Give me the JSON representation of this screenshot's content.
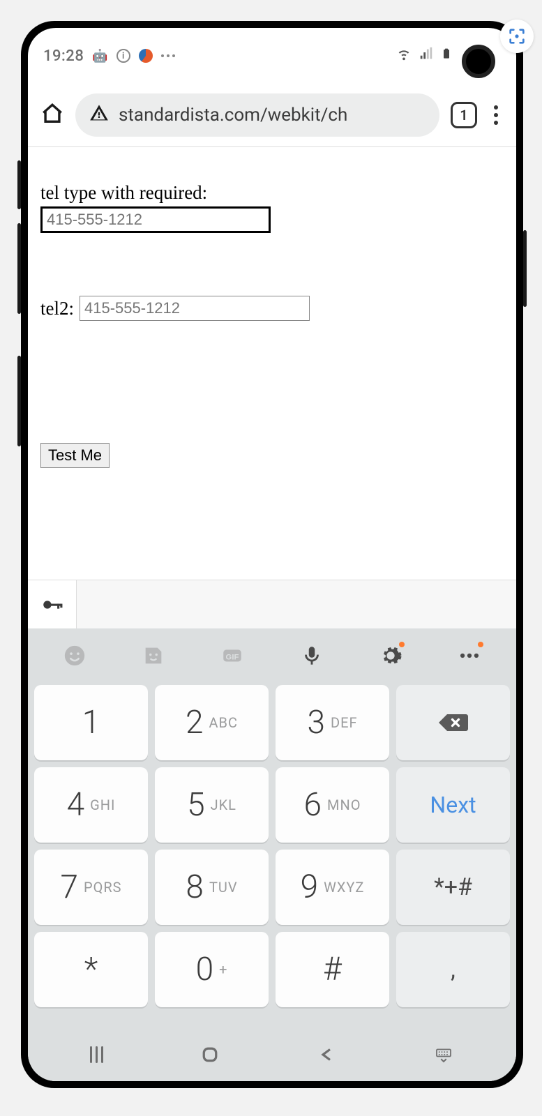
{
  "statusbar": {
    "time": "19:28",
    "icons": [
      "android-icon",
      "info-icon",
      "swirl-icon",
      "more-icon"
    ],
    "right_icons": [
      "wifi-icon",
      "signal-icon",
      "battery-icon"
    ]
  },
  "browser": {
    "url": "standardista.com/webkit/ch",
    "tab_count": "1"
  },
  "page": {
    "label1": "tel type with required:",
    "tel1_placeholder": "415-555-1212",
    "label2": "tel2:",
    "tel2_placeholder": "415-555-1212",
    "button": "Test Me"
  },
  "keyboard": {
    "toolbar": [
      "emoji",
      "sticker",
      "gif",
      "mic",
      "settings",
      "more"
    ],
    "rows": [
      [
        {
          "n": "1",
          "s": ""
        },
        {
          "n": "2",
          "s": "ABC"
        },
        {
          "n": "3",
          "s": "DEF"
        },
        {
          "fn": "backspace"
        }
      ],
      [
        {
          "n": "4",
          "s": "GHI"
        },
        {
          "n": "5",
          "s": "JKL"
        },
        {
          "n": "6",
          "s": "MNO"
        },
        {
          "fn": "next",
          "label": "Next"
        }
      ],
      [
        {
          "n": "7",
          "s": "PQRS"
        },
        {
          "n": "8",
          "s": "TUV"
        },
        {
          "n": "9",
          "s": "WXYZ"
        },
        {
          "fn": "sym",
          "label": "*+#"
        }
      ],
      [
        {
          "n": "*",
          "s": ""
        },
        {
          "n": "0",
          "s": "+"
        },
        {
          "n": "#",
          "s": ""
        },
        {
          "fn": "sym",
          "label": ","
        }
      ]
    ]
  },
  "navbar": [
    "recents",
    "home",
    "back",
    "keyboard-hide"
  ]
}
